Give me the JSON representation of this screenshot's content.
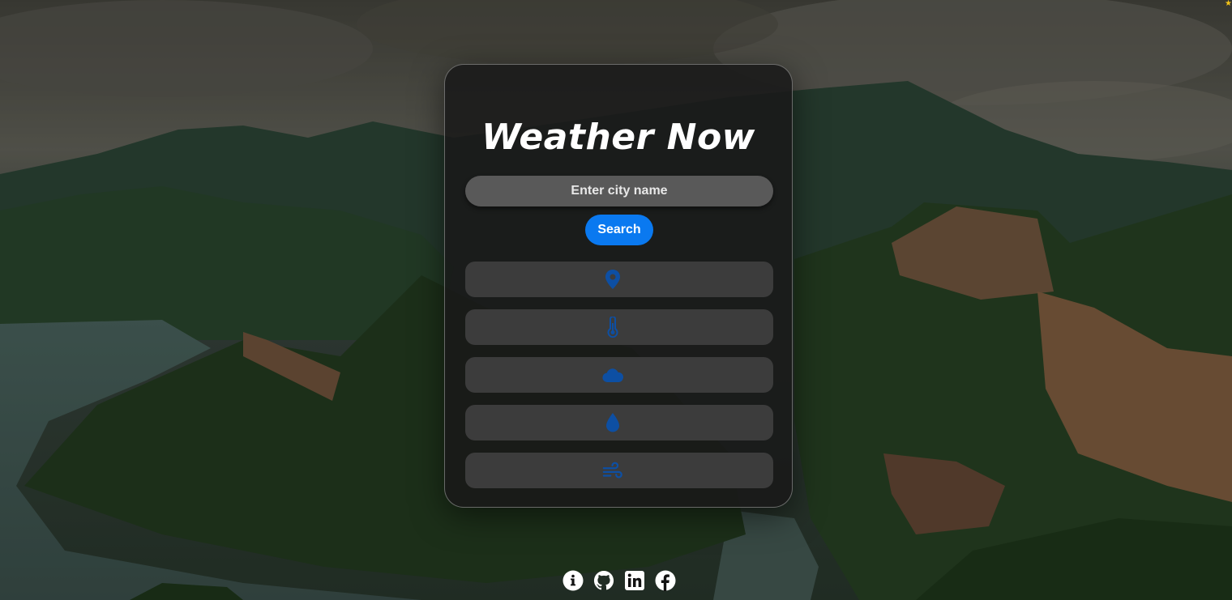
{
  "app": {
    "title": "Weather Now"
  },
  "search": {
    "placeholder": "Enter city name",
    "value": "",
    "button_label": "Search"
  },
  "weather_rows": [
    {
      "icon": "location-pin-icon",
      "value": ""
    },
    {
      "icon": "thermometer-icon",
      "value": ""
    },
    {
      "icon": "cloud-icon",
      "value": ""
    },
    {
      "icon": "droplet-icon",
      "value": ""
    },
    {
      "icon": "wind-icon",
      "value": ""
    }
  ],
  "footer": {
    "links": [
      {
        "icon": "info-icon"
      },
      {
        "icon": "github-icon"
      },
      {
        "icon": "linkedin-icon"
      },
      {
        "icon": "facebook-icon"
      }
    ]
  },
  "colors": {
    "accent": "#0a79f0",
    "icon_blue": "#0d4fa3",
    "card_bg": "#181818",
    "row_bg": "#3c3c3c",
    "input_bg": "#595959"
  }
}
